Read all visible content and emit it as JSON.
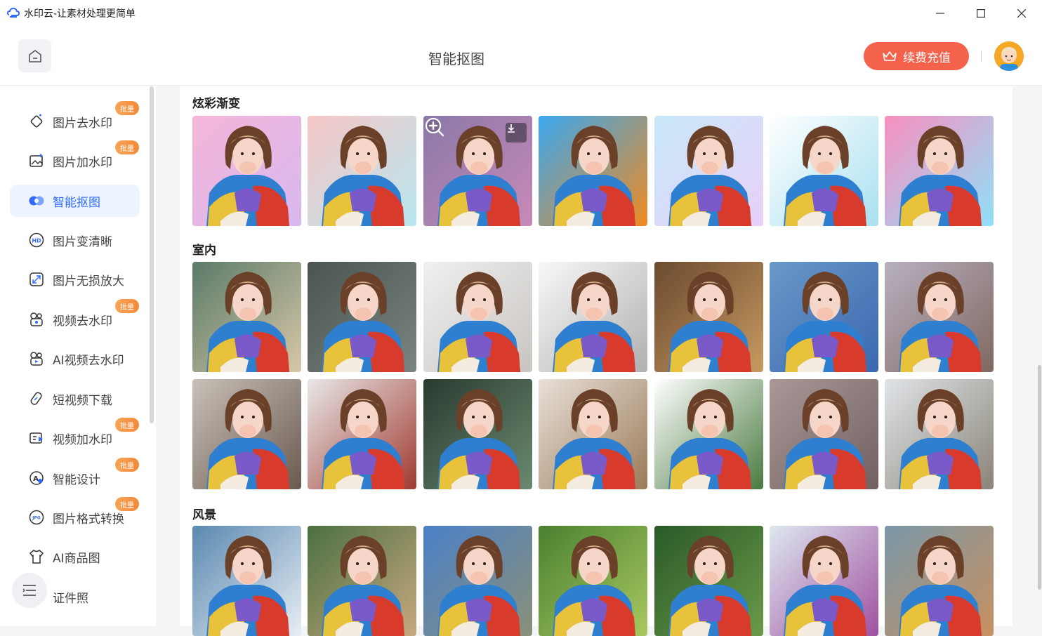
{
  "window": {
    "title": "水印云-让素材处理更简单"
  },
  "header": {
    "page_title": "智能抠图",
    "recharge_label": "续费充值"
  },
  "colors": {
    "accent": "#2f6bff",
    "recharge": "#f5624c",
    "badge": "#f28a39"
  },
  "sidebar": {
    "items": [
      {
        "label": "图片去水印",
        "icon": "image-eraser-icon",
        "badge": "批量",
        "active": false
      },
      {
        "label": "图片加水印",
        "icon": "image-add-icon",
        "badge": "批量",
        "active": false
      },
      {
        "label": "智能抠图",
        "icon": "cutout-icon",
        "badge": "",
        "active": true
      },
      {
        "label": "图片变清晰",
        "icon": "hd-icon",
        "badge": "",
        "active": false
      },
      {
        "label": "图片无损放大",
        "icon": "enlarge-icon",
        "badge": "",
        "active": false
      },
      {
        "label": "视频去水印",
        "icon": "video-eraser-icon",
        "badge": "批量",
        "active": false
      },
      {
        "label": "AI视频去水印",
        "icon": "ai-video-icon",
        "badge": "",
        "active": false
      },
      {
        "label": "短视频下载",
        "icon": "download-link-icon",
        "badge": "",
        "active": false
      },
      {
        "label": "视频加水印",
        "icon": "video-add-icon",
        "badge": "批量",
        "active": false
      },
      {
        "label": "智能设计",
        "icon": "design-icon",
        "badge": "批量",
        "active": false
      },
      {
        "label": "图片格式转换",
        "icon": "jpg-icon",
        "badge": "批量",
        "active": false
      },
      {
        "label": "AI商品图",
        "icon": "tshirt-icon",
        "badge": "",
        "active": false
      },
      {
        "label": "证件照",
        "icon": "id-photo-icon",
        "badge": "",
        "active": false
      }
    ]
  },
  "sections": [
    {
      "title": "炫彩渐变"
    },
    {
      "title": "室内"
    },
    {
      "title": "风景"
    }
  ]
}
